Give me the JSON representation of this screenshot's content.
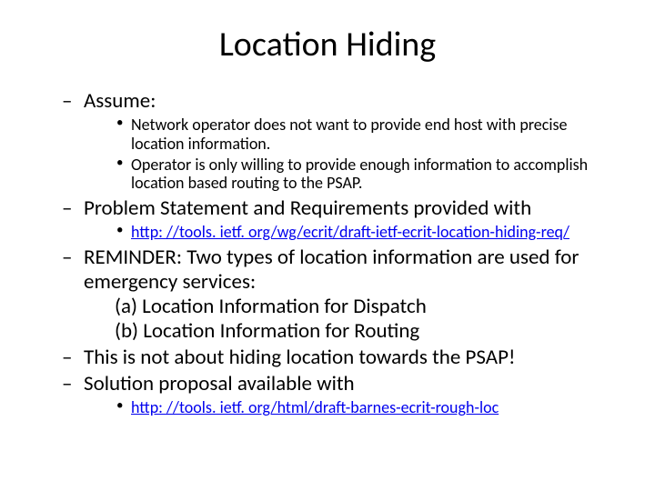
{
  "title": "Location Hiding",
  "items": [
    {
      "text": "Assume:",
      "sub": [
        {
          "text": "Network operator does not want to provide end host with precise location information."
        },
        {
          "text": "Operator is only willing to provide enough information to accomplish location based routing to the PSAP."
        }
      ]
    },
    {
      "text": "Problem Statement and Requirements provided with",
      "sub": [
        {
          "link": "http: //tools. ietf. org/wg/ecrit/draft-ietf-ecrit-location-hiding-req/"
        }
      ]
    },
    {
      "text": "REMINDER: Two types of location information are used for emergency services:",
      "lines": [
        "(a) Location Information for Dispatch",
        "(b) Location Information for Routing"
      ]
    },
    {
      "text": "This is not about hiding location towards the PSAP!"
    },
    {
      "text": "Solution proposal available with",
      "sub": [
        {
          "link": "http: //tools. ietf. org/html/draft-barnes-ecrit-rough-loc"
        }
      ]
    }
  ]
}
